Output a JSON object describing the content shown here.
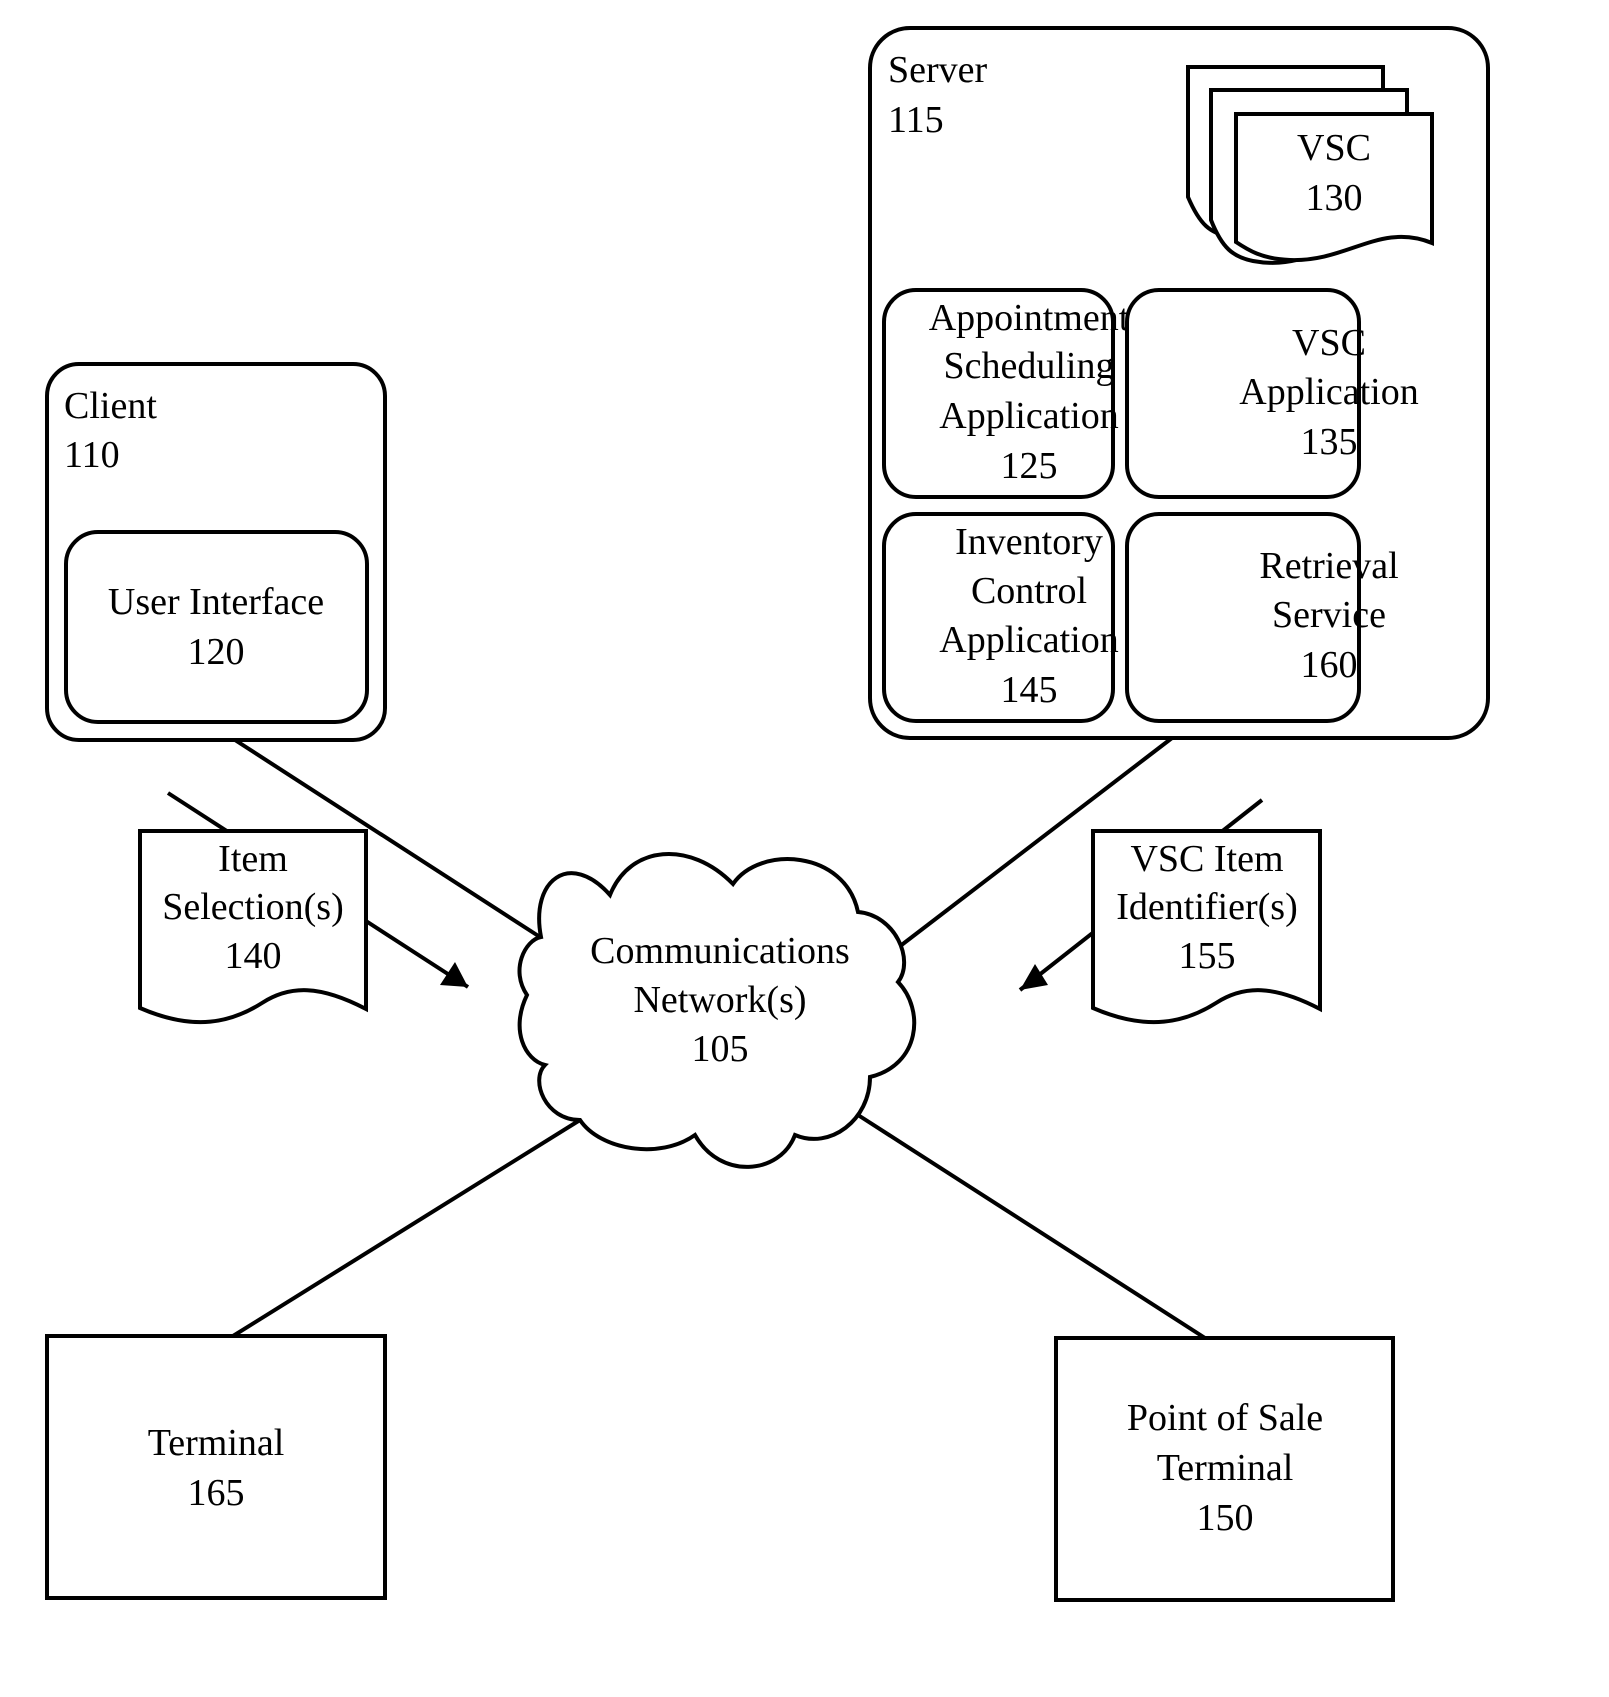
{
  "diagram": {
    "client": {
      "title": "Client",
      "number": "110"
    },
    "user_interface": {
      "lines": [
        "User Interface",
        "120"
      ]
    },
    "server": {
      "title": "Server",
      "number": "115"
    },
    "vsc_docs": {
      "lines": [
        "VSC",
        "130"
      ]
    },
    "appointment": {
      "lines": [
        "Appointment",
        "Scheduling",
        "Application",
        "125"
      ]
    },
    "vsc_app": {
      "lines": [
        "VSC",
        "Application",
        "135"
      ]
    },
    "inventory": {
      "lines": [
        "Inventory",
        "Control",
        "Application",
        "145"
      ]
    },
    "retrieval": {
      "lines": [
        "Retrieval",
        "Service",
        "160"
      ]
    },
    "item_selection": {
      "lines": [
        "Item",
        "Selection(s)",
        "140"
      ]
    },
    "vsc_item_identifier": {
      "lines": [
        "VSC Item",
        "Identifier(s)",
        "155"
      ]
    },
    "network": {
      "lines": [
        "Communications",
        "Network(s)",
        "105"
      ]
    },
    "terminal": {
      "lines": [
        "Terminal",
        "165"
      ]
    },
    "pos_terminal": {
      "lines": [
        "Point of Sale",
        "Terminal",
        "150"
      ]
    }
  }
}
